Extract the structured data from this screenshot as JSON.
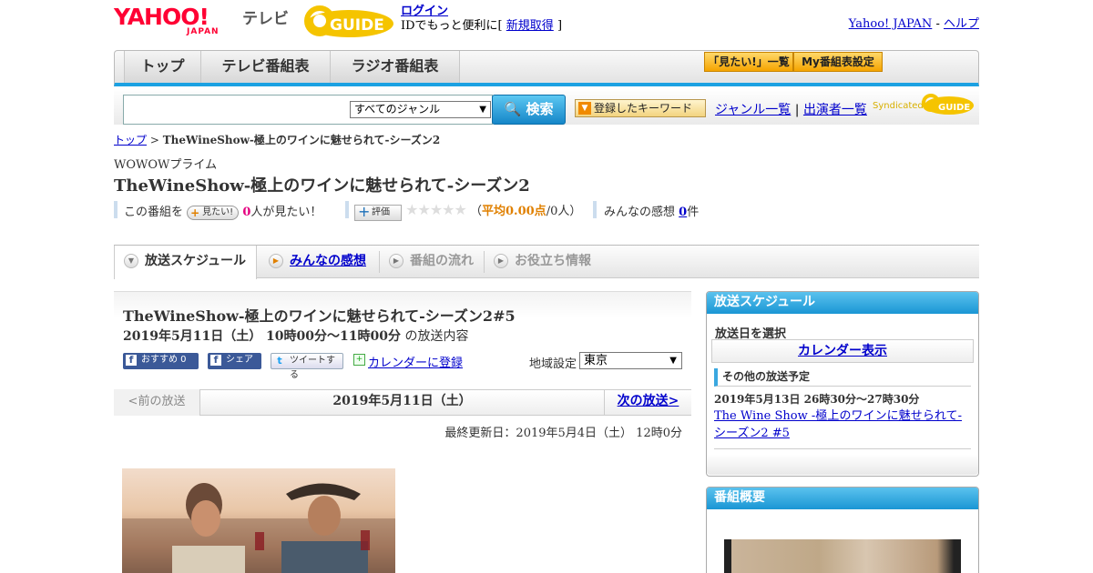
{
  "header": {
    "yahoo_logo_text": "YAHOO!",
    "yahoo_logo_sub": "JAPAN",
    "tv_label": "テレビ",
    "gguide_logo_text": "GUIDE",
    "login_link": "ログイン",
    "login_text_pre": "IDでもっと便利に[",
    "register_link": "新規取得",
    "login_text_post": "]",
    "yahoo_japan_link": "Yahoo! JAPAN",
    "separator": "-",
    "help_link": "ヘルプ"
  },
  "nav": {
    "tabs": [
      {
        "label": "トップ"
      },
      {
        "label": "テレビ番組表"
      },
      {
        "label": "ラジオ番組表"
      }
    ],
    "mitai_list_button": "「見たい!」一覧",
    "my_schedule_button": "My番組表設定"
  },
  "search": {
    "input_value": "",
    "genre_selected": "すべてのジャンル",
    "search_button": "検索",
    "keyword_button": "登録したキーワード",
    "genre_list_link": "ジャンル一覧",
    "link_separator": "|",
    "cast_list_link": "出演者一覧",
    "syndicated_label": "Syndicated"
  },
  "breadcrumb": {
    "top_link": "トップ",
    "separator": ">",
    "current": "TheWineShow-極上のワインに魅せられて-シーズン2"
  },
  "program": {
    "channel": "WOWOWプライム",
    "title": "TheWineShow-極上のワインに魅せられて-シーズン2",
    "mitai_prefix": "この番組を",
    "mitai_button": "見たい!",
    "mitai_count": "0",
    "mitai_suffix": "人が見たい！",
    "rating_button": "評価",
    "stars_filled": 0,
    "stars_total": 5,
    "stars_display": "★★★★★",
    "rating_open": "（",
    "rating_avg": "平均0.00点",
    "rating_people": "/0人）",
    "kanso_label": "みんなの感想",
    "kanso_count": "0",
    "kanso_suffix": "件"
  },
  "detail_tabs": [
    {
      "label": "放送スケジュール"
    },
    {
      "label": "みんなの感想"
    },
    {
      "label": "番組の流れ"
    },
    {
      "label": "お役立ち情報"
    }
  ],
  "episode": {
    "title": "TheWineShow-極上のワインに魅せられて-シーズン2#5",
    "date_time": "2019年5月11日（土）  10時00分～11時00分",
    "date_suffix": "の放送内容",
    "recommend_button": "おすすめ 0",
    "share_button": "シェア",
    "tweet_button": "ツイートする",
    "calendar_link": "カレンダーに登録",
    "region_label": "地域設定",
    "region_selected": "東京"
  },
  "pager": {
    "prev": "<前の放送",
    "current_date": "2019年5月11日（土）",
    "next": "次の放送>"
  },
  "updated": "最終更新日：2019年5月4日（土）  12時0分",
  "sidebar": {
    "schedule_header": "放送スケジュール",
    "select_date_label": "放送日を選択",
    "calendar_button": "カレンダー表示",
    "other_header": "その他の放送予定",
    "other_date": "2019年5月13日  26時30分～27時30分",
    "other_link": "The Wine Show -極上のワインに魅せられて- シーズン2 #5",
    "summary_header": "番組概要"
  },
  "colors": {
    "accent_blue": "#1ba1e2",
    "link": "#0000cc",
    "yahoo_red": "#ff0033",
    "gguide_yellow": "#f5c400",
    "mitai_count_color": "#e4007f",
    "rating_color": "#e08000"
  }
}
